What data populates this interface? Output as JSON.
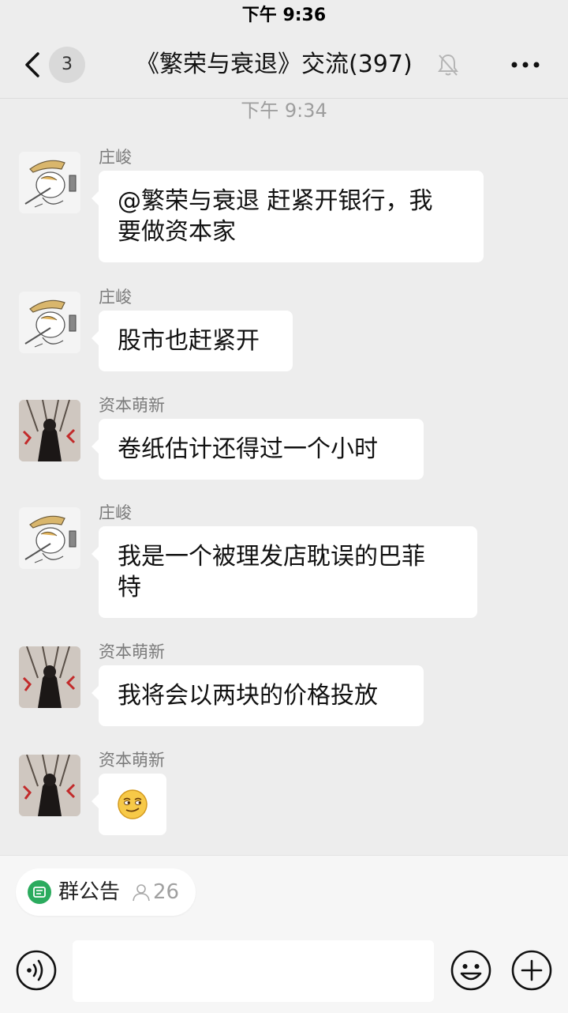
{
  "status_bar": {
    "time": "下午 9:36"
  },
  "header": {
    "unread_count": "3",
    "title": "《繁荣与衰退》交流(397)",
    "muted": true
  },
  "timestamp": "下午 9:34",
  "messages": [
    {
      "sender": "庄峻",
      "text": "@繁荣与衰退 赶紧开银行，我\n要做资本家",
      "avatar": "duck-sticker-avatar"
    },
    {
      "sender": "庄峻",
      "text": "股市也赶紧开",
      "avatar": "duck-sticker-avatar"
    },
    {
      "sender": "资本萌新",
      "text": "卷纸估计还得过一个小时",
      "avatar": "dark-figure-avatar"
    },
    {
      "sender": "庄峻",
      "text": "我是一个被理发店耽误的巴菲\n特",
      "avatar": "duck-sticker-avatar"
    },
    {
      "sender": "资本萌新",
      "text": "我将会以两块的价格投放",
      "avatar": "dark-figure-avatar"
    },
    {
      "sender": "资本萌新",
      "text": "",
      "emoji": "smirk-emoji",
      "avatar": "dark-figure-avatar"
    }
  ],
  "group_notice": {
    "label": "群公告",
    "member_count": "26"
  },
  "input": {
    "placeholder": ""
  },
  "colors": {
    "background": "#ededed",
    "bubble": "#ffffff",
    "notice_icon": "#2bab5e"
  }
}
